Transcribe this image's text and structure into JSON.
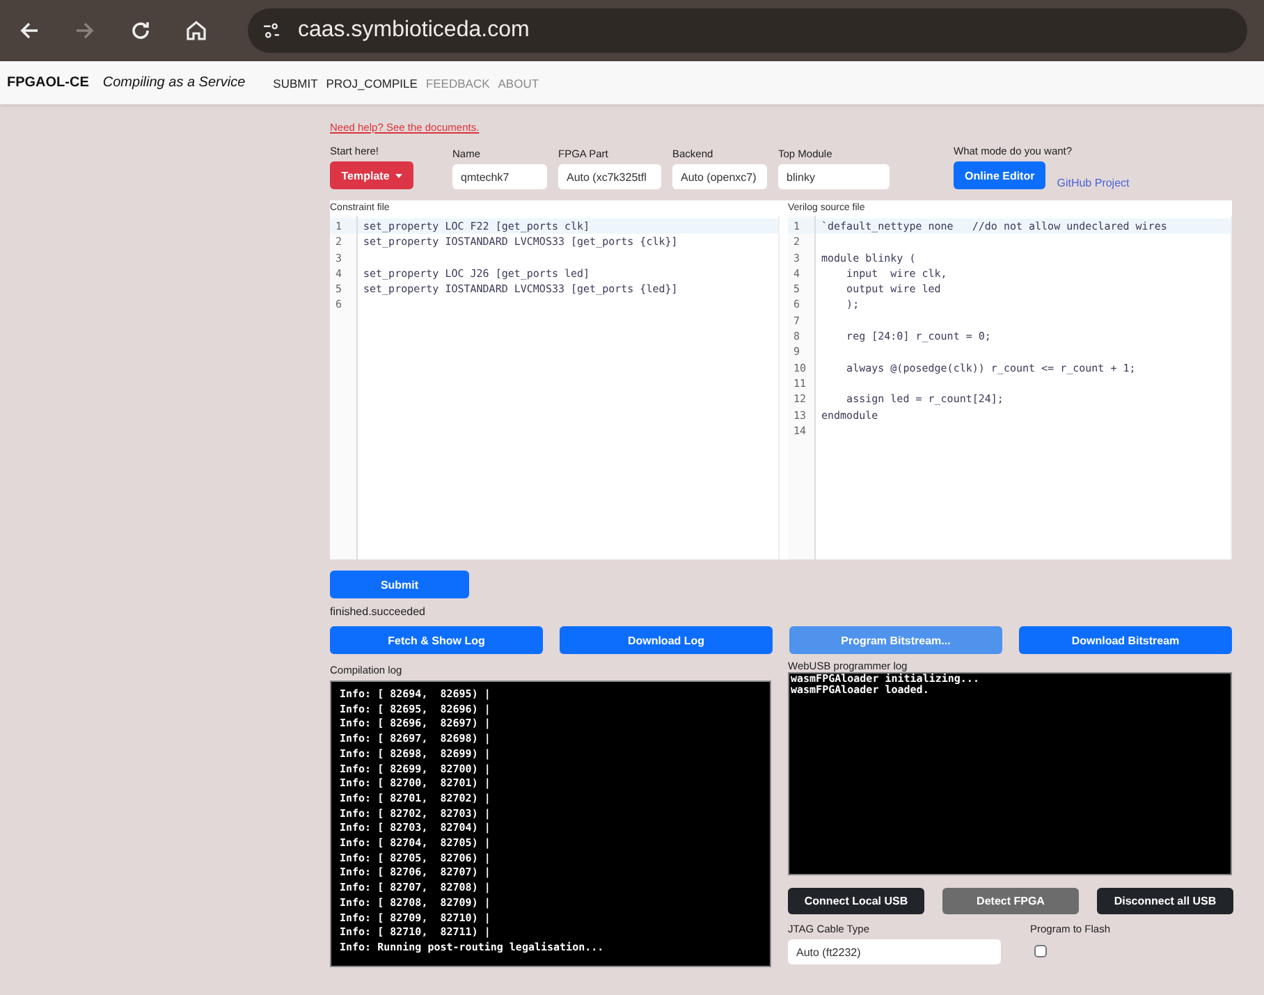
{
  "browser": {
    "url": "caas.symbioticeda.com",
    "forward_disabled": true
  },
  "navbar": {
    "brand": "FPGAOL-CE",
    "tagline": "Compiling as a Service",
    "links": [
      {
        "label": "SUBMIT",
        "active": true
      },
      {
        "label": "PROJ_COMPILE",
        "active": true
      },
      {
        "label": "FEEDBACK",
        "active": false
      },
      {
        "label": "ABOUT",
        "active": false
      }
    ]
  },
  "help_link": "Need help? See the documents.",
  "settings": {
    "start_label": "Start here!",
    "template_button": "Template",
    "fields": [
      {
        "label": "Name",
        "value": "qmtechk7"
      },
      {
        "label": "FPGA Part",
        "value": "Auto (xc7k325tfl"
      },
      {
        "label": "Backend",
        "value": "Auto (openxc7)"
      },
      {
        "label": "Top Module",
        "value": "blinky"
      }
    ],
    "mode_label": "What mode do you want?",
    "modes": [
      {
        "label": "Online Editor",
        "selected": true
      },
      {
        "label": "GitHub Project",
        "selected": false
      }
    ]
  },
  "editors": [
    {
      "label": "Constraint file",
      "lines": [
        {
          "number": "1",
          "code": "set_property LOC F22 [get_ports clk]",
          "highlighted": true
        },
        {
          "number": "2",
          "code": "set_property IOSTANDARD LVCMOS33 [get_ports {clk}]",
          "highlighted": false
        },
        {
          "number": "3",
          "highlighted": false
        },
        {
          "number": "4",
          "code": "set_property LOC J26 [get_ports led]",
          "highlighted": false
        },
        {
          "number": "5",
          "code": "set_property IOSTANDARD LVCMOS33 [get_ports {led}]",
          "highlighted": false
        },
        {
          "number": "6",
          "highlighted": false
        }
      ]
    },
    {
      "label": "Verilog source file",
      "lines": [
        {
          "number": "1",
          "code": "`default_nettype none   //do not allow undeclared wires",
          "highlighted": true
        },
        {
          "number": "2",
          "highlighted": false
        },
        {
          "number": "3",
          "code": "module blinky (",
          "highlighted": false
        },
        {
          "number": "4",
          "code": "    input  wire clk,",
          "highlighted": false
        },
        {
          "number": "5",
          "code": "    output wire led",
          "highlighted": false
        },
        {
          "number": "6",
          "code": "    );",
          "highlighted": false
        },
        {
          "number": "7",
          "highlighted": false
        },
        {
          "number": "8",
          "code": "    reg [24:0] r_count = 0;",
          "highlighted": false
        },
        {
          "number": "9",
          "highlighted": false
        },
        {
          "number": "10",
          "code": "    always @(posedge(clk)) r_count <= r_count + 1;",
          "highlighted": false
        },
        {
          "number": "11",
          "highlighted": false
        },
        {
          "number": "12",
          "code": "    assign led = r_count[24];",
          "highlighted": false
        },
        {
          "number": "13",
          "code": "endmodule",
          "highlighted": false
        },
        {
          "number": "14",
          "highlighted": false
        }
      ]
    }
  ],
  "submit_button": "Submit",
  "status": "finished.succeeded",
  "actions": [
    {
      "label": "Fetch & Show Log",
      "disabled": false
    },
    {
      "label": "Download Log",
      "disabled": false
    },
    {
      "label": "Program Bitstream...",
      "disabled": true
    },
    {
      "label": "Download Bitstream",
      "disabled": false
    }
  ],
  "compilation_log": {
    "label": "Compilation log",
    "lines": [
      "Info: [ 82694,  82695) |",
      "Info: [ 82695,  82696) |",
      "Info: [ 82696,  82697) |",
      "Info: [ 82697,  82698) |",
      "Info: [ 82698,  82699) |",
      "Info: [ 82699,  82700) |",
      "Info: [ 82700,  82701) |",
      "Info: [ 82701,  82702) |",
      "Info: [ 82702,  82703) |",
      "Info: [ 82703,  82704) |",
      "Info: [ 82704,  82705) |",
      "Info: [ 82705,  82706) |",
      "Info: [ 82706,  82707) |",
      "Info: [ 82707,  82708) |",
      "Info: [ 82708,  82709) |",
      "Info: [ 82709,  82710) |",
      "Info: [ 82710,  82711) |",
      "Info: Running post-routing legalisation..."
    ]
  },
  "programmer_log": {
    "label": "WebUSB programmer log",
    "lines": [
      "wasmFPGAloader initializing...",
      "wasmFPGAloader loaded."
    ]
  },
  "usb_buttons": [
    {
      "label": "Connect Local USB",
      "disabled": false
    },
    {
      "label": "Detect FPGA",
      "disabled": true
    },
    {
      "label": "Disconnect all USB",
      "disabled": false
    }
  ],
  "jtag": {
    "label": "JTAG Cable Type",
    "value": "Auto (ft2232)"
  },
  "flash": {
    "label": "Program to Flash",
    "checked": false
  }
}
